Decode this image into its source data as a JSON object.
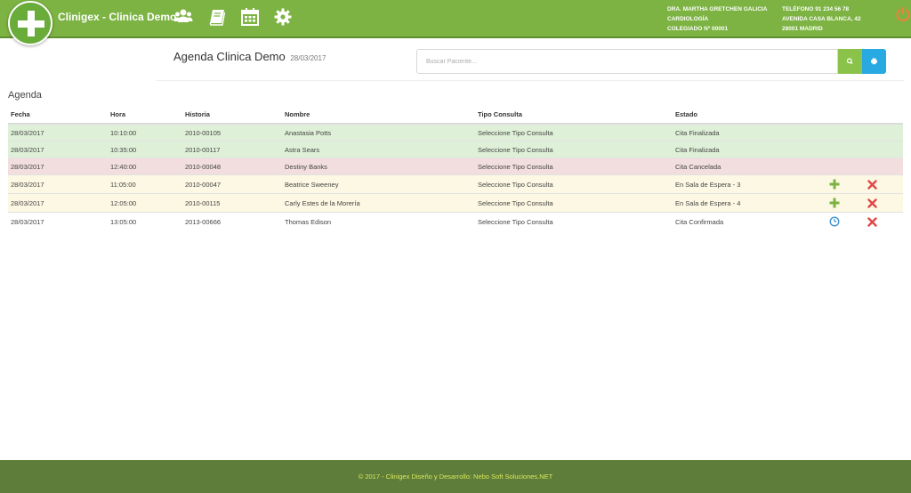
{
  "app": {
    "title": "Clinigex - Clinica Demo",
    "accent": "#7cb342",
    "footer_color": "#5f7d3a"
  },
  "nav": {
    "icons": [
      "users-icon",
      "book-icon",
      "calendar-icon",
      "gear-icon"
    ],
    "power_icon": "power-icon"
  },
  "doctor": {
    "name": "DRA. MARTHA GRETCHEN GALICIA",
    "specialty": "CARDIOLOGÍA",
    "collegiate": "COLEGIADO Nº 00001"
  },
  "clinic": {
    "phone": "TELÉFONO 91 234 56 78",
    "address": "AVENIDA CASA BLANCA, 42",
    "city": "28001 MADRID"
  },
  "header": {
    "title": "Agenda Clinica Demo",
    "date": "28/03/2017"
  },
  "search": {
    "placeholder": "Buscar Paciente...",
    "value": ""
  },
  "agenda": {
    "title": "Agenda",
    "columns": [
      "Fecha",
      "Hora",
      "Historia",
      "Nombre",
      "Tipo Consulta",
      "Estado"
    ],
    "rows": [
      {
        "fecha": "28/03/2017",
        "hora": "10:10:00",
        "historia": "2010-00105",
        "nombre": "Anastasia Potts",
        "tipo": "Seleccione Tipo Consulta",
        "estado": "Cita Finalizada",
        "status": "finalizada"
      },
      {
        "fecha": "28/03/2017",
        "hora": "10:35:00",
        "historia": "2010-00117",
        "nombre": "Astra Sears",
        "tipo": "Seleccione Tipo Consulta",
        "estado": "Cita Finalizada",
        "status": "finalizada"
      },
      {
        "fecha": "28/03/2017",
        "hora": "12:40:00",
        "historia": "2010-00048",
        "nombre": "Destiny Banks",
        "tipo": "Seleccione Tipo Consulta",
        "estado": "Cita Cancelada",
        "status": "cancelada"
      },
      {
        "fecha": "28/03/2017",
        "hora": "11:05:00",
        "historia": "2010-00047",
        "nombre": "Beatrice Sweeney",
        "tipo": "Seleccione Tipo Consulta",
        "estado": "En Sala de Espera - 3",
        "status": "espera"
      },
      {
        "fecha": "28/03/2017",
        "hora": "12:05:00",
        "historia": "2010-00115",
        "nombre": "Carly Estes de la Morería",
        "tipo": "Seleccione Tipo Consulta",
        "estado": "En Sala de Espera - 4",
        "status": "espera"
      },
      {
        "fecha": "28/03/2017",
        "hora": "13:05:00",
        "historia": "2013-00666",
        "nombre": "Thomas Edison",
        "tipo": "Seleccione Tipo Consulta",
        "estado": "Cita Confirmada",
        "status": "confirmada"
      }
    ]
  },
  "status_colors": {
    "finalizada": "#dff0d8",
    "cancelada": "#f2dede",
    "espera": "#fcf8e3",
    "confirmada": "#ffffff"
  },
  "footer": {
    "text": "© 2017 - Clinigex Diseño y Desarrollo: Nebo Soft Soluciones.NET"
  }
}
